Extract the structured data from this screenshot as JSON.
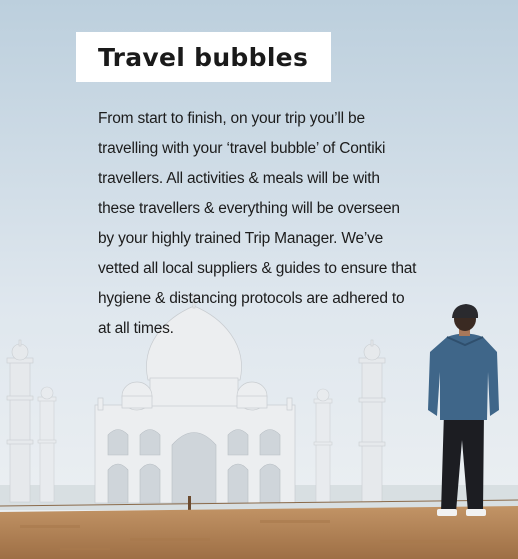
{
  "card": {
    "title": "Travel bubbles",
    "body": "From start to finish, on your trip you’ll be travelling with your ‘travel bubble’ of Contiki travellers. All activities & meals will be with these travellers & everything will be overseen by your highly trained Trip Manager. We’ve vetted all local suppliers & guides to ensure that hygiene & distancing protocols are adhered to at all times."
  },
  "colors": {
    "sky_top": "#c3d3df",
    "sky_bottom": "#e9eef2",
    "marble": "#eef0f2",
    "ground": "#b8875a",
    "jacket": "#3f6689"
  }
}
